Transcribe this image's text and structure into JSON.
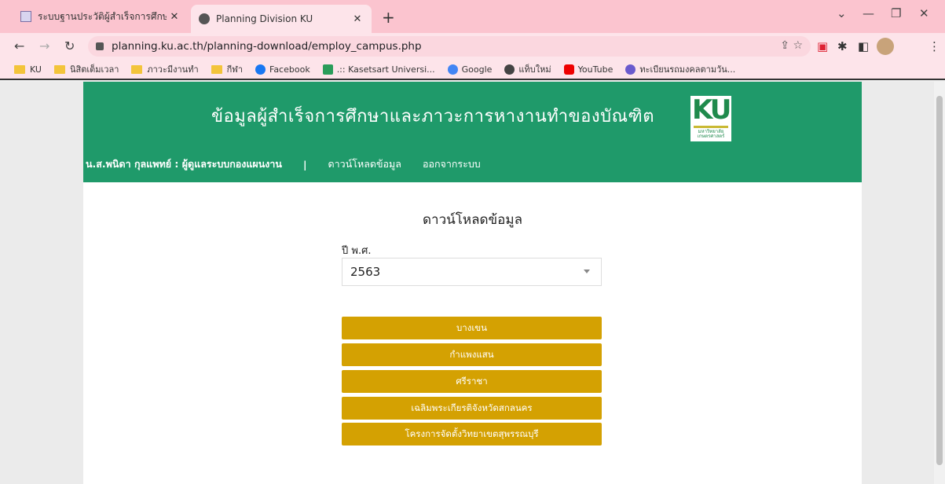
{
  "browser": {
    "tabs": [
      {
        "title": "ระบบฐานประวัติผู้สำเร็จการศึกษาและภ",
        "active": false
      },
      {
        "title": "Planning Division KU",
        "active": true
      }
    ],
    "url": "planning.ku.ac.th/planning-download/employ_campus.php",
    "bookmarks": [
      {
        "label": "KU",
        "icon": "folder-icon"
      },
      {
        "label": "นิสิตเต็มเวลา",
        "icon": "folder-icon"
      },
      {
        "label": "ภาวะมีงานทำ",
        "icon": "folder-icon"
      },
      {
        "label": "กีฬา",
        "icon": "folder-icon"
      },
      {
        "label": "Facebook",
        "icon": "facebook-icon"
      },
      {
        "label": ".:: Kasetsart Universi...",
        "icon": "ku-icon"
      },
      {
        "label": "Google",
        "icon": "google-icon"
      },
      {
        "label": "แท็บใหม่",
        "icon": "globe-icon"
      },
      {
        "label": "YouTube",
        "icon": "youtube-icon"
      },
      {
        "label": "ทะเบียนรถมงคลตามวัน...",
        "icon": "site-icon"
      }
    ]
  },
  "site": {
    "title": "ข้อมูลผู้สำเร็จการศึกษาและภาวะการหางานทำของบัณฑิต",
    "logo_text": "KU",
    "logo_sub": "มหาวิทยาลัยเกษตรศาสตร์",
    "nav": {
      "user": "น.ส.พนิดา กุลแพทย์ : ผู้ดูแลระบบกองแผนงาน",
      "separator": "|",
      "download": "ดาวน์โหลดข้อมูล",
      "logout": "ออกจากระบบ"
    }
  },
  "content": {
    "title": "ดาวน์โหลดข้อมูล",
    "year_label": "ปี พ.ศ.",
    "year_value": "2563",
    "campuses": [
      "บางเขน",
      "กำแพงแสน",
      "ศรีราชา",
      "เฉลิมพระเกียรติจังหวัดสกลนคร",
      "โครงการจัดตั้งวิทยาเขตสุพรรณบุรี"
    ]
  },
  "colors": {
    "header_green": "#1f9a6a",
    "button_gold": "#d4a102",
    "tabstrip_pink": "#fbc4cf"
  }
}
